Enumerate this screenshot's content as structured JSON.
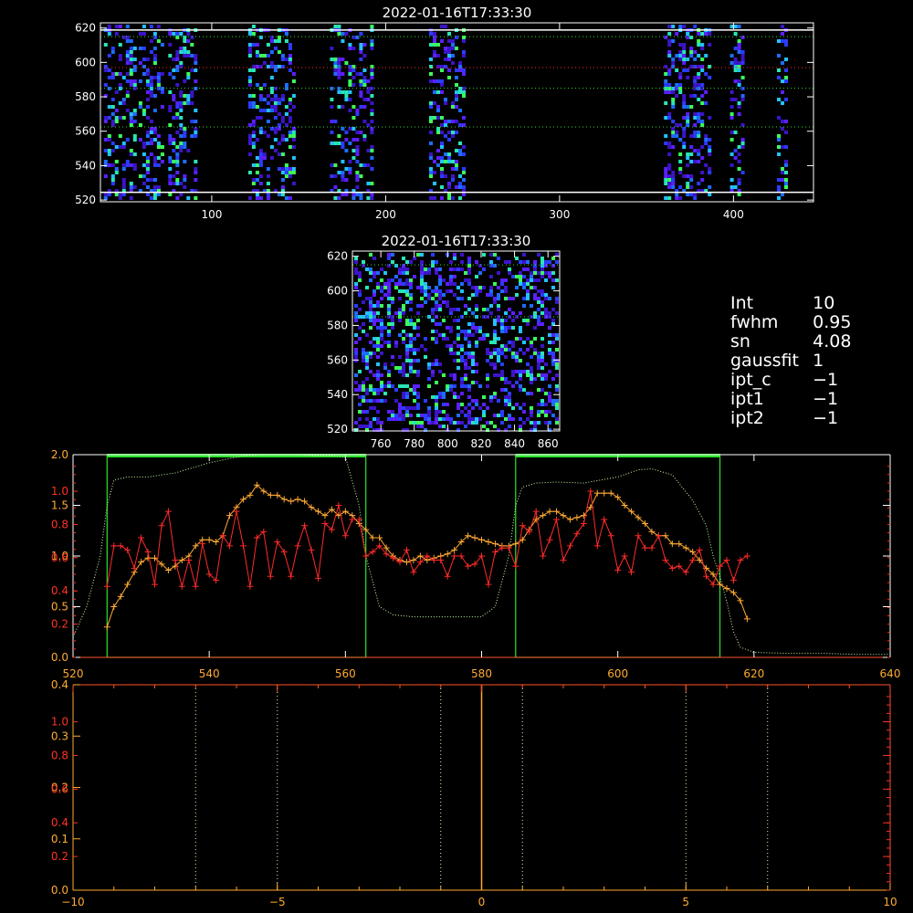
{
  "colors": {
    "background": "#000000",
    "axis": "#ffffff",
    "axis_bottom": "#ff4f2b",
    "green": "#2ee22e",
    "orange": "#ffaa33",
    "red": "#ff2a2a",
    "red_ticks": "#ff3322",
    "pale_green": "#ccffaa"
  },
  "params": [
    {
      "key": "Int",
      "value": "10"
    },
    {
      "key": "fwhm",
      "value": "0.95"
    },
    {
      "key": "sn",
      "value": "4.08"
    },
    {
      "key": "gaussfit",
      "value": "1"
    },
    {
      "key": "ipt_c",
      "value": "−1"
    },
    {
      "key": "ipt1",
      "value": "−1"
    },
    {
      "key": "ipt2",
      "value": "−1"
    }
  ],
  "chart_data": [
    {
      "type": "heatmap",
      "title": "2022-01-16T17:33:30",
      "xlim": [
        36,
        446
      ],
      "ylim": [
        519,
        623
      ],
      "xticks": [
        "100",
        "200",
        "300",
        "400"
      ],
      "xtick_values": [
        100,
        200,
        300,
        400
      ],
      "yticks": [
        "520",
        "540",
        "560",
        "580",
        "600",
        "620"
      ],
      "ytick_values": [
        520,
        540,
        560,
        580,
        600,
        620
      ],
      "white_lines_y": [
        524.5,
        618.8
      ],
      "green_lines_y": [
        562.5,
        585,
        615
      ],
      "red_lines_y": [
        597
      ],
      "bands": [
        [
          38,
          55
        ],
        [
          58,
          72
        ],
        [
          75,
          90
        ],
        [
          121,
          148
        ],
        [
          168,
          193
        ],
        [
          225,
          245
        ],
        [
          360,
          386
        ],
        [
          398,
          405
        ],
        [
          425,
          431
        ]
      ],
      "colormap": [
        "#3c14c8",
        "#5a20ff",
        "#2a3cff",
        "#1e6cff",
        "#22c2ff",
        "#28e6b4",
        "#3cff5a"
      ]
    },
    {
      "type": "heatmap",
      "title": "2022-01-16T17:33:30",
      "xlim": [
        743,
        867
      ],
      "ylim": [
        519,
        623
      ],
      "xticks": [
        "760",
        "780",
        "800",
        "820",
        "840",
        "860"
      ],
      "xtick_values": [
        760,
        780,
        800,
        820,
        840,
        860
      ],
      "yticks": [
        "520",
        "540",
        "560",
        "580",
        "600",
        "620"
      ],
      "ytick_values": [
        520,
        540,
        560,
        580,
        600,
        620
      ],
      "green_lines_y": [
        585,
        615
      ],
      "colormap": [
        "#3c14c8",
        "#5a20ff",
        "#2a3cff",
        "#1e6cff",
        "#22c2ff",
        "#28e6b4",
        "#3cff5a"
      ]
    },
    {
      "type": "line",
      "xlim": [
        520,
        640
      ],
      "xticks": [
        "520",
        "540",
        "560",
        "580",
        "600",
        "620",
        "640"
      ],
      "xtick_values": [
        520,
        540,
        560,
        580,
        600,
        620,
        640
      ],
      "ylim": [
        0,
        2
      ],
      "yticks": [
        "0.0",
        "0.5",
        "1.0",
        "1.5",
        "2.0"
      ],
      "ytick_values": [
        0,
        0.5,
        1.0,
        1.5,
        2.0
      ],
      "red_axis_ticks": [
        "0.2",
        "0.4",
        "0.6",
        "0.8",
        "1.0"
      ],
      "red_axis_tick_values": [
        0.2,
        0.4,
        0.6,
        0.8,
        1.0
      ],
      "red_axis_ylim": [
        0,
        1.22
      ],
      "boxes_x": [
        [
          525,
          563
        ],
        [
          585,
          615
        ]
      ],
      "profile_x": [
        520,
        522,
        524,
        525,
        526,
        528,
        531,
        535,
        540,
        545,
        548,
        550,
        553,
        556,
        558,
        560,
        562,
        563,
        565,
        567,
        570,
        575,
        580,
        582,
        584,
        585,
        586,
        588,
        591,
        595,
        600,
        603,
        605,
        608,
        611,
        613,
        614,
        615,
        616,
        617,
        618,
        620,
        625,
        630,
        635,
        640
      ],
      "profile_y": [
        0.2,
        0.5,
        1.0,
        1.5,
        1.75,
        1.78,
        1.78,
        1.82,
        1.92,
        1.99,
        2.0,
        2.0,
        2.0,
        1.99,
        1.99,
        1.98,
        1.5,
        1.0,
        0.5,
        0.42,
        0.4,
        0.4,
        0.4,
        0.5,
        1.0,
        1.5,
        1.68,
        1.72,
        1.73,
        1.72,
        1.78,
        1.85,
        1.86,
        1.8,
        1.55,
        1.3,
        1.0,
        0.8,
        0.55,
        0.25,
        0.1,
        0.05,
        0.04,
        0.04,
        0.03,
        0.03
      ],
      "series": [
        {
          "name": "",
          "color": "orange",
          "x": [
            525,
            526,
            527,
            528,
            529,
            530,
            531,
            532,
            533,
            534,
            535,
            536,
            537,
            538,
            539,
            540,
            541,
            542,
            543,
            544,
            545,
            546,
            547,
            548,
            549,
            550,
            551,
            552,
            553,
            554,
            555,
            556,
            557,
            558,
            559,
            560,
            561,
            562,
            563,
            564,
            565,
            566,
            567,
            568,
            569,
            570,
            571,
            572,
            573,
            574,
            575,
            576,
            577,
            578,
            579,
            580,
            581,
            582,
            583,
            584,
            585,
            586,
            587,
            588,
            589,
            590,
            591,
            592,
            593,
            594,
            595,
            596,
            597,
            598,
            599,
            600,
            601,
            602,
            603,
            604,
            605,
            606,
            607,
            608,
            609,
            610,
            611,
            612,
            613,
            614,
            615,
            616,
            617,
            618,
            619
          ],
          "y": [
            0.15,
            0.25,
            0.3,
            0.36,
            0.42,
            0.47,
            0.49,
            0.49,
            0.46,
            0.43,
            0.45,
            0.48,
            0.5,
            0.55,
            0.58,
            0.58,
            0.57,
            0.6,
            0.7,
            0.74,
            0.78,
            0.8,
            0.85,
            0.82,
            0.8,
            0.8,
            0.78,
            0.77,
            0.78,
            0.77,
            0.74,
            0.72,
            0.7,
            0.73,
            0.7,
            0.72,
            0.7,
            0.66,
            0.63,
            0.59,
            0.59,
            0.54,
            0.5,
            0.48,
            0.47,
            0.48,
            0.5,
            0.48,
            0.49,
            0.5,
            0.51,
            0.53,
            0.57,
            0.6,
            0.59,
            0.58,
            0.57,
            0.56,
            0.55,
            0.55,
            0.56,
            0.58,
            0.63,
            0.68,
            0.7,
            0.72,
            0.72,
            0.7,
            0.68,
            0.69,
            0.7,
            0.74,
            0.81,
            0.81,
            0.81,
            0.79,
            0.75,
            0.72,
            0.69,
            0.66,
            0.62,
            0.6,
            0.6,
            0.56,
            0.56,
            0.54,
            0.52,
            0.48,
            0.44,
            0.41,
            0.36,
            0.34,
            0.32,
            0.28,
            0.19
          ]
        },
        {
          "name": "",
          "color": "red",
          "x": [
            525,
            526,
            527,
            528,
            529,
            530,
            531,
            532,
            533,
            534,
            535,
            536,
            537,
            538,
            539,
            540,
            541,
            542,
            543,
            544,
            545,
            546,
            547,
            548,
            549,
            550,
            551,
            552,
            553,
            554,
            555,
            556,
            557,
            558,
            559,
            560,
            561,
            562,
            563,
            564,
            565,
            566,
            567,
            568,
            569,
            570,
            571,
            572,
            573,
            574,
            575,
            576,
            577,
            578,
            579,
            580,
            581,
            582,
            583,
            584,
            585,
            586,
            587,
            588,
            589,
            590,
            591,
            592,
            593,
            594,
            595,
            596,
            597,
            598,
            599,
            600,
            601,
            602,
            603,
            604,
            605,
            606,
            607,
            608,
            609,
            610,
            611,
            612,
            613,
            614,
            615,
            616,
            617,
            618,
            619
          ],
          "y": [
            0.35,
            0.55,
            0.55,
            0.53,
            0.44,
            0.59,
            0.52,
            0.36,
            0.65,
            0.72,
            0.48,
            0.35,
            0.48,
            0.35,
            0.56,
            0.41,
            0.38,
            0.6,
            0.55,
            0.72,
            0.55,
            0.35,
            0.59,
            0.62,
            0.4,
            0.57,
            0.52,
            0.4,
            0.55,
            0.65,
            0.53,
            0.39,
            0.66,
            0.63,
            0.75,
            0.6,
            0.68,
            0.68,
            0.5,
            0.52,
            0.55,
            0.51,
            0.49,
            0.47,
            0.53,
            0.42,
            0.47,
            0.5,
            0.48,
            0.48,
            0.4,
            0.5,
            0.5,
            0.45,
            0.46,
            0.5,
            0.36,
            0.52,
            0.54,
            0.54,
            0.45,
            0.65,
            0.62,
            0.72,
            0.5,
            0.58,
            0.68,
            0.48,
            0.55,
            0.61,
            0.66,
            0.82,
            0.55,
            0.68,
            0.6,
            0.43,
            0.5,
            0.42,
            0.6,
            0.54,
            0.54,
            0.6,
            0.48,
            0.44,
            0.45,
            0.42,
            0.48,
            0.53,
            0.4,
            0.36,
            0.45,
            0.48,
            0.38,
            0.48,
            0.5
          ]
        }
      ]
    },
    {
      "type": "line",
      "xlim": [
        -10,
        10
      ],
      "xticks": [
        "−10",
        "−5",
        "0",
        "5",
        "10"
      ],
      "xtick_values": [
        -10,
        -5,
        0,
        5,
        10
      ],
      "ylim": [
        0,
        0.4
      ],
      "yticks": [
        "0.0",
        "0.1",
        "0.2",
        "0.3",
        "0.4"
      ],
      "ytick_values": [
        0,
        0.1,
        0.2,
        0.3,
        0.4
      ],
      "red_axis_ticks": [
        "0.2",
        "0.4",
        "0.6",
        "0.8",
        "1.0"
      ],
      "red_axis_tick_values": [
        0.2,
        0.4,
        0.6,
        0.8,
        1.0
      ],
      "red_axis_ylim": [
        0,
        1.22
      ],
      "dotted_lines_x": [
        -7,
        -5,
        -1,
        1,
        5,
        7
      ],
      "orange_line_x": 0
    }
  ]
}
